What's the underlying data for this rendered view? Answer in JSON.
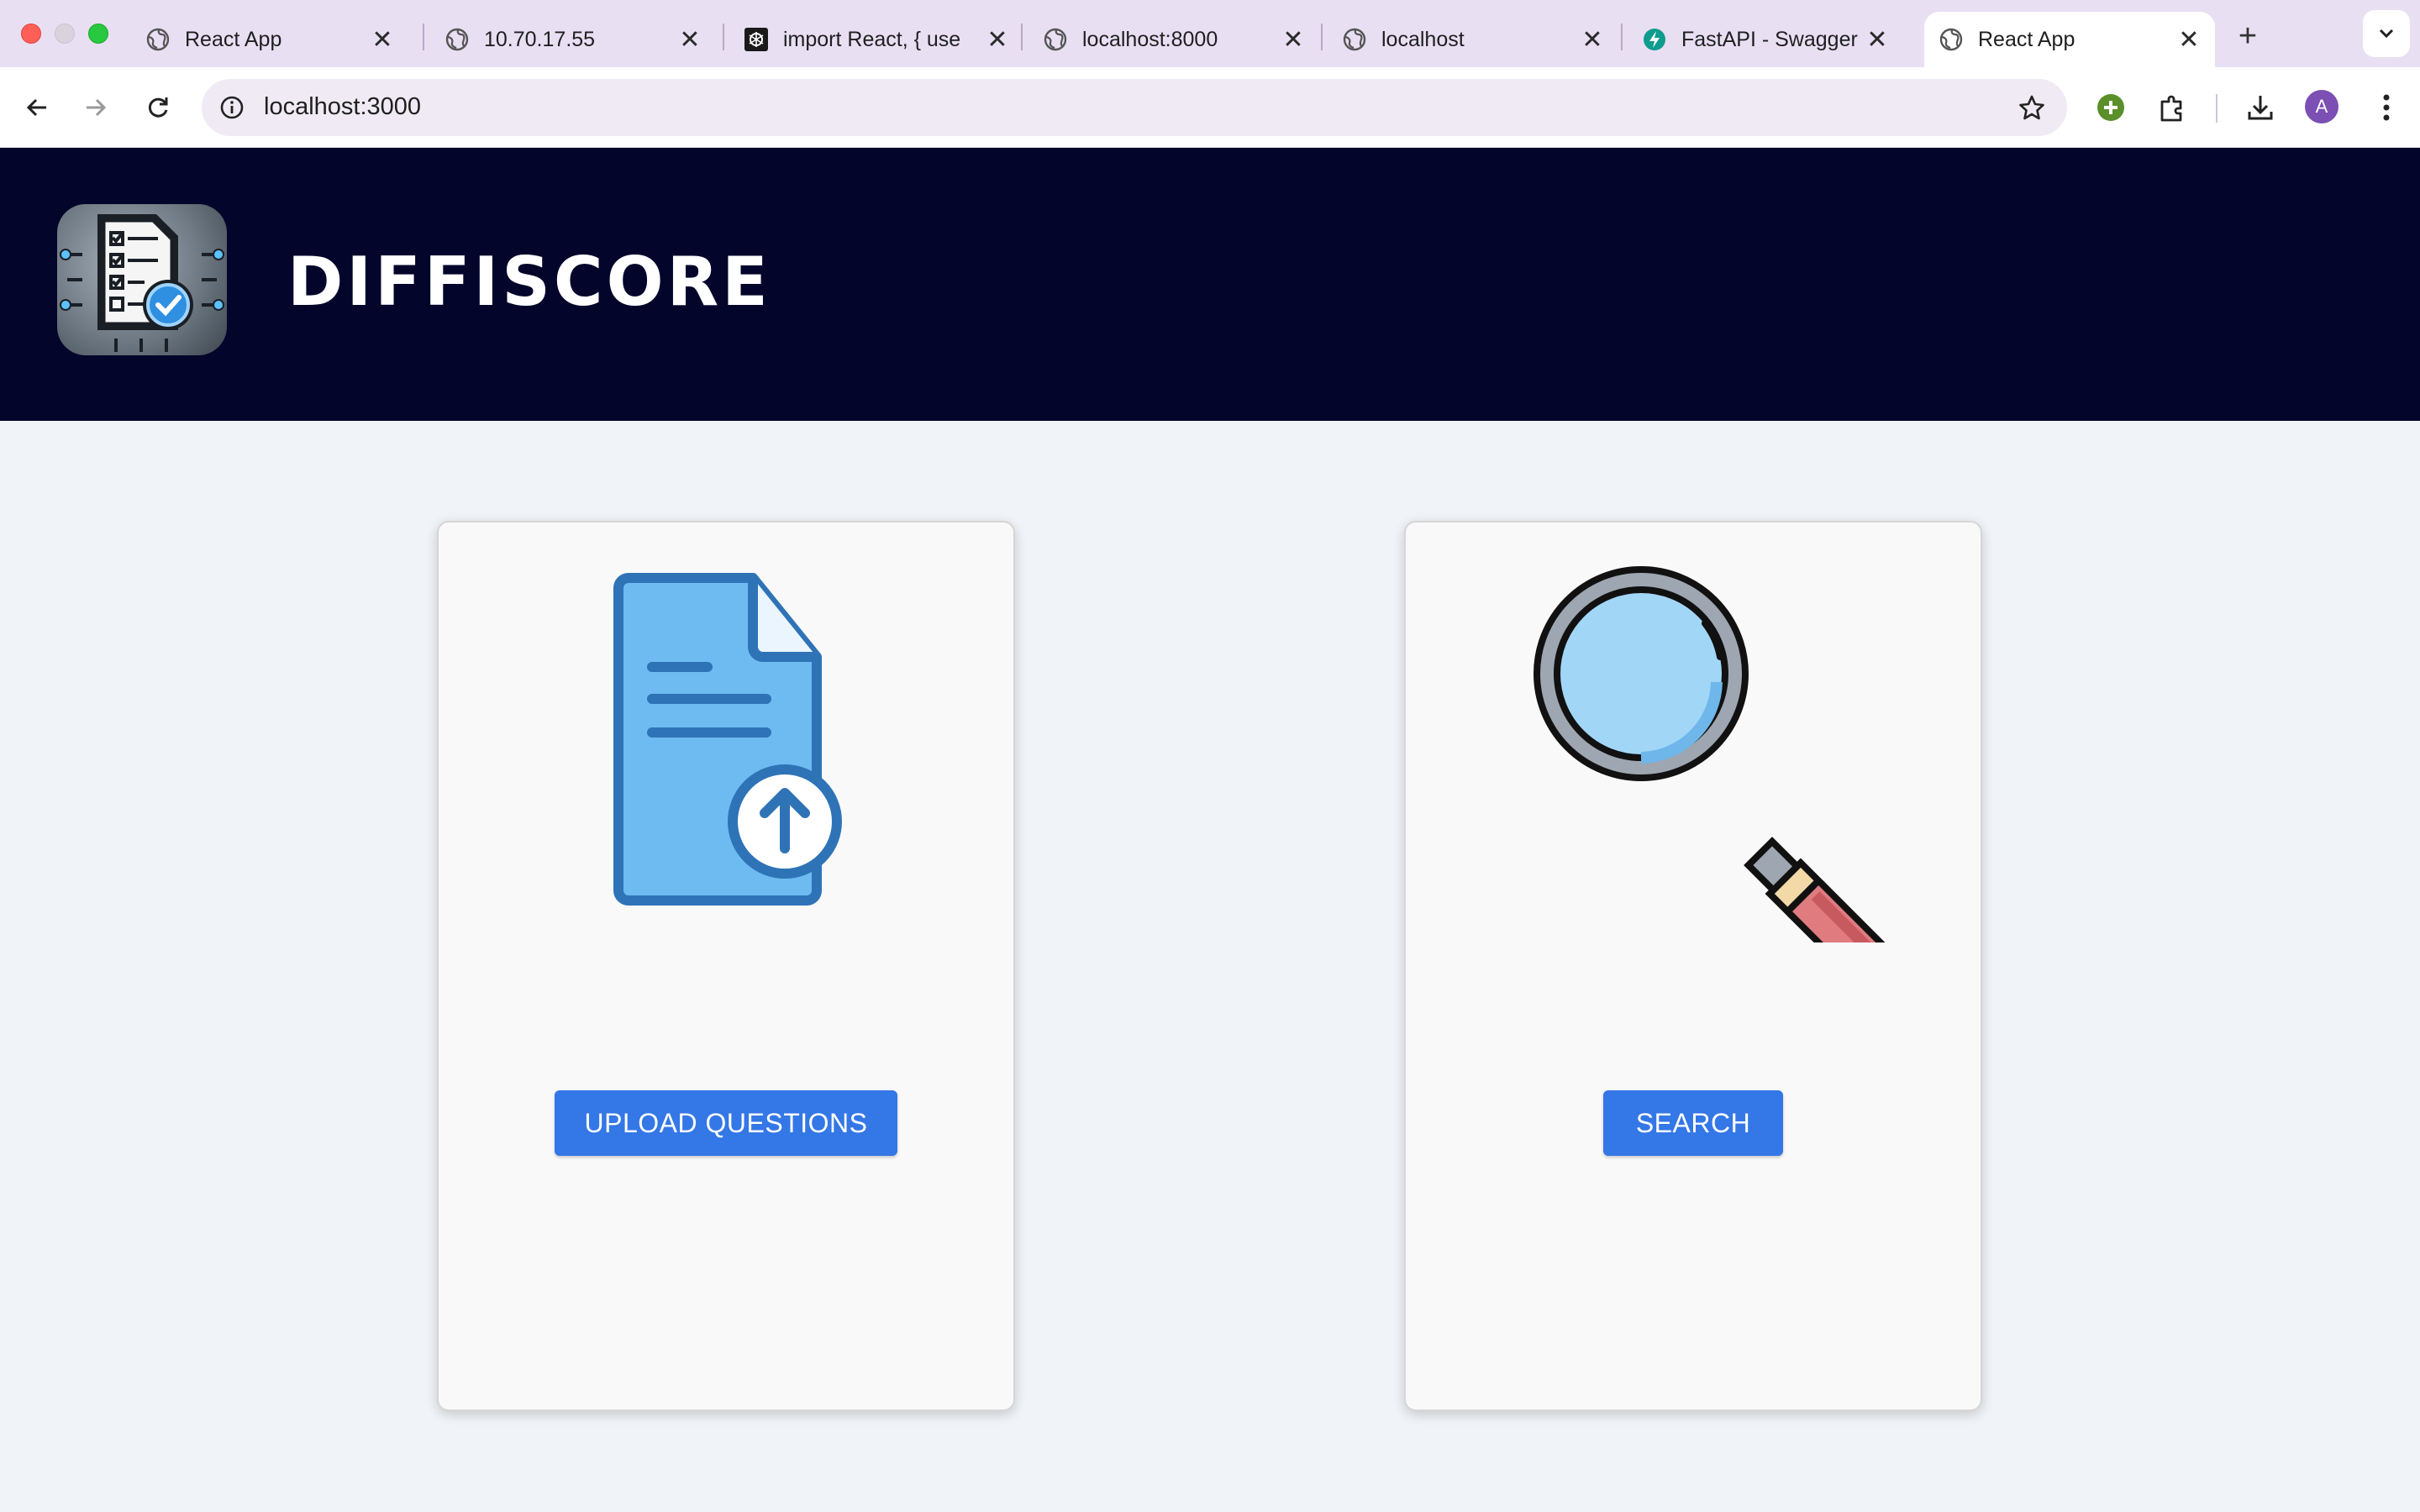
{
  "browser": {
    "tabs": [
      {
        "title": "React App",
        "icon": "globe-icon",
        "active": false
      },
      {
        "title": "10.70.17.55",
        "icon": "globe-icon",
        "active": false
      },
      {
        "title": "import React, { use",
        "icon": "openai-icon",
        "active": false
      },
      {
        "title": "localhost:8000",
        "icon": "globe-icon",
        "active": false
      },
      {
        "title": "localhost",
        "icon": "globe-icon",
        "active": false
      },
      {
        "title": "FastAPI - Swagger",
        "icon": "fastapi-icon",
        "active": false
      },
      {
        "title": "React App",
        "icon": "globe-icon",
        "active": true
      }
    ],
    "new_tab_label": "+",
    "close_glyph": "✕",
    "address": {
      "url": "localhost:3000"
    },
    "profile_initial": "A",
    "colors": {
      "tabstrip": "#e9dff3",
      "omnibox": "#efeaf4",
      "avatar": "#7b4fb3"
    }
  },
  "app": {
    "title": "DIFFISCORE",
    "header_color": "#03052b",
    "logo": "checklist-chip-logo"
  },
  "cards": {
    "upload": {
      "icon": "upload-document-icon",
      "button_label": "UPLOAD QUESTIONS"
    },
    "search": {
      "icon": "magnifying-glass-icon",
      "button_label": "SEARCH"
    }
  },
  "colors": {
    "button": "#3477e6",
    "page_background": "#f0f4f8",
    "card_background": "#f9f9f9"
  }
}
